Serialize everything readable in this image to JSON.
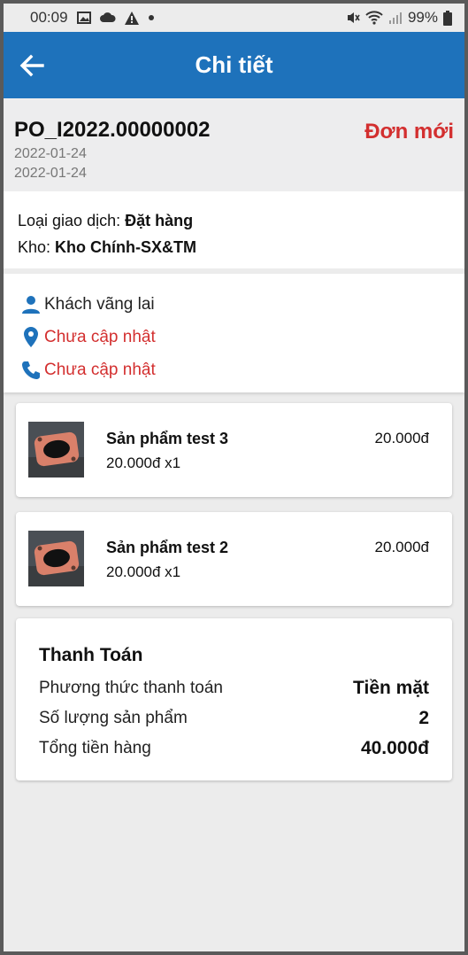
{
  "status_bar": {
    "time": "00:09",
    "battery": "99%",
    "icons": [
      "image-icon",
      "cloud-icon",
      "warning-icon",
      "dot-icon",
      "mute-icon",
      "wifi-icon",
      "signal-icon",
      "battery-icon"
    ]
  },
  "appbar": {
    "title": "Chi tiết",
    "color": "#1e72bb"
  },
  "order": {
    "code": "PO_I2022.00000002",
    "date1": "2022-01-24",
    "date2": "2022-01-24",
    "status": "Đơn mới"
  },
  "info": {
    "transaction_label": "Loại giao dịch: ",
    "transaction_value": "Đặt hàng",
    "warehouse_label": "Kho: ",
    "warehouse_value": "Kho Chính-SX&TM"
  },
  "customer": {
    "name": "Khách vãng lai",
    "address": "Chưa cập nhật",
    "phone": "Chưa cập nhật"
  },
  "products": [
    {
      "name": "Sản phẩm test 3",
      "price_qty": "20.000đ x1",
      "total": "20.000đ"
    },
    {
      "name": "Sản phẩm test 2",
      "price_qty": "20.000đ x1",
      "total": "20.000đ"
    }
  ],
  "payment": {
    "title": "Thanh Toán",
    "method_label": "Phương thức thanh toán",
    "method_value": "Tiền mặt",
    "count_label": "Số lượng sản phẩm",
    "count_value": "2",
    "total_label": "Tổng tiền hàng",
    "total_value": "40.000đ"
  }
}
